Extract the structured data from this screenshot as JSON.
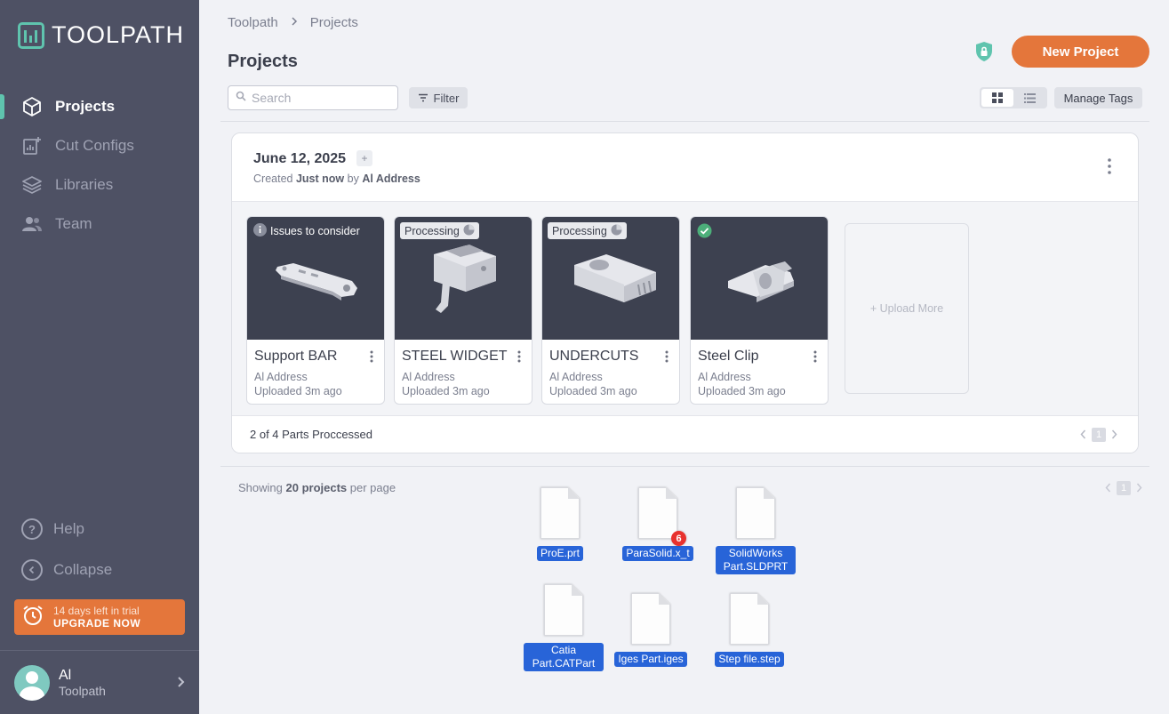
{
  "app": {
    "logo_text": "TOOLPATH"
  },
  "sidebar": {
    "items": [
      {
        "label": "Projects",
        "icon": "cube-icon",
        "active": true
      },
      {
        "label": "Cut Configs",
        "icon": "cut-config-icon"
      },
      {
        "label": "Libraries",
        "icon": "layers-icon"
      },
      {
        "label": "Team",
        "icon": "team-icon"
      }
    ],
    "help_label": "Help",
    "collapse_label": "Collapse",
    "trial": {
      "line1": "14 days left in trial",
      "line2": "UPGRADE NOW"
    },
    "user": {
      "name": "Al",
      "org": "Toolpath"
    }
  },
  "header": {
    "breadcrumb": [
      "Toolpath",
      "Projects"
    ],
    "title": "Projects",
    "new_project_label": "New Project"
  },
  "toolbar": {
    "search_placeholder": "Search",
    "filter_label": "Filter",
    "manage_tags_label": "Manage Tags"
  },
  "project": {
    "date": "June 12, 2025",
    "plus": "+",
    "created_prefix": "Created",
    "created_when": "Just now",
    "created_by_prefix": "by",
    "created_by": "Al Address",
    "parts": [
      {
        "name": "Support BAR",
        "owner": "Al Address",
        "uploaded": "Uploaded 3m ago",
        "status": "Issues to consider",
        "status_type": "issue"
      },
      {
        "name": "STEEL WIDGET",
        "owner": "Al Address",
        "uploaded": "Uploaded 3m ago",
        "status": "Processing",
        "status_type": "processing"
      },
      {
        "name": "UNDERCUTS",
        "owner": "Al Address",
        "uploaded": "Uploaded 3m ago",
        "status": "Processing",
        "status_type": "processing"
      },
      {
        "name": "Steel Clip",
        "owner": "Al Address",
        "uploaded": "Uploaded 3m ago",
        "status": "",
        "status_type": "done"
      }
    ],
    "upload_more_label": "+ Upload More",
    "footer_text": "2 of 4 Parts Proccessed",
    "page": "1"
  },
  "list_footer": {
    "showing_prefix": "Showing",
    "showing_count": "20 projects",
    "showing_suffix": "per page",
    "page": "1"
  },
  "desktop_files": [
    {
      "label": "ProE.prt"
    },
    {
      "label": "ParaSolid.x_t",
      "badge": "6"
    },
    {
      "label": "SolidWorks Part.SLDPRT"
    },
    {
      "label": "Catia Part.CATPart"
    },
    {
      "label": "Iges Part.iges"
    },
    {
      "label": "Step file.step"
    }
  ],
  "colors": {
    "sidebar": "#4e5164",
    "accent": "#e4763b",
    "teal": "#5fc4ae",
    "selection": "#2864d8"
  }
}
